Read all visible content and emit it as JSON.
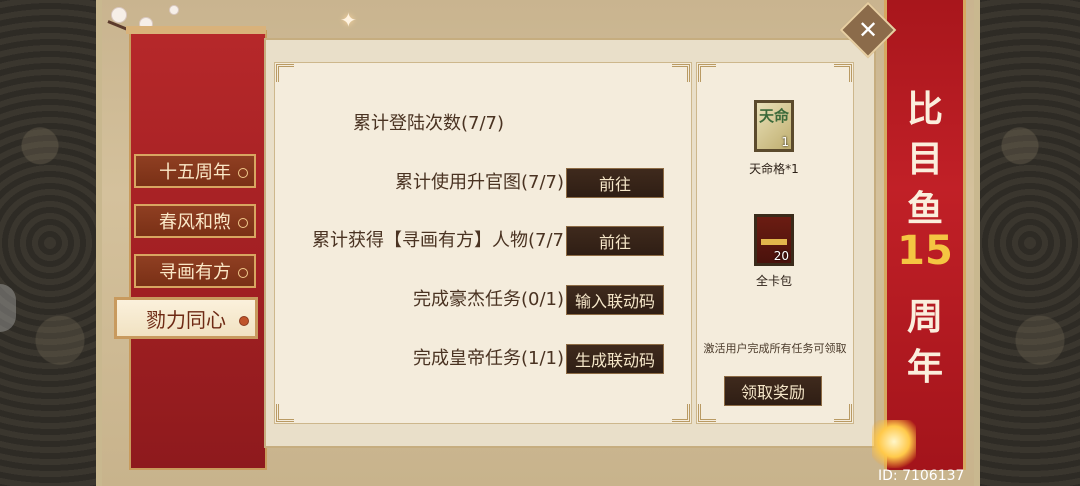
{
  "tabs": [
    {
      "label": "十五周年"
    },
    {
      "label": "春风和煦"
    },
    {
      "label": "寻画有方"
    },
    {
      "label": "勠力同心"
    }
  ],
  "active_tab": "勠力同心",
  "tasks": [
    {
      "label": "累计登陆次数(7/7)",
      "button": ""
    },
    {
      "label": "累计使用升官图(7/7)",
      "button": "前往"
    },
    {
      "label": "累计获得【寻画有方】人物(7/7",
      "button": "前往"
    },
    {
      "label": "完成豪杰任务(0/1)",
      "button": "输入联动码"
    },
    {
      "label": "完成皇帝任务(1/1)",
      "button": "生成联动码"
    }
  ],
  "rewards": [
    {
      "name": "天命格*1",
      "count": "1",
      "icon": "tianming-token-icon",
      "icon_text": "天命"
    },
    {
      "name": "全卡包",
      "count": "20",
      "icon": "card-pack-icon"
    }
  ],
  "reward_note": "激活用户完成所有任务可领取",
  "claim_button": "领取奖励",
  "banner": {
    "chars": [
      "比",
      "目",
      "鱼",
      "15",
      "周",
      "年"
    ]
  },
  "user_id": "ID: 7106137",
  "colors": {
    "banner_red": "#b51c22",
    "button_dark": "#3a2619",
    "paper": "#f4ecdc",
    "accent_gold": "#d6a860"
  }
}
